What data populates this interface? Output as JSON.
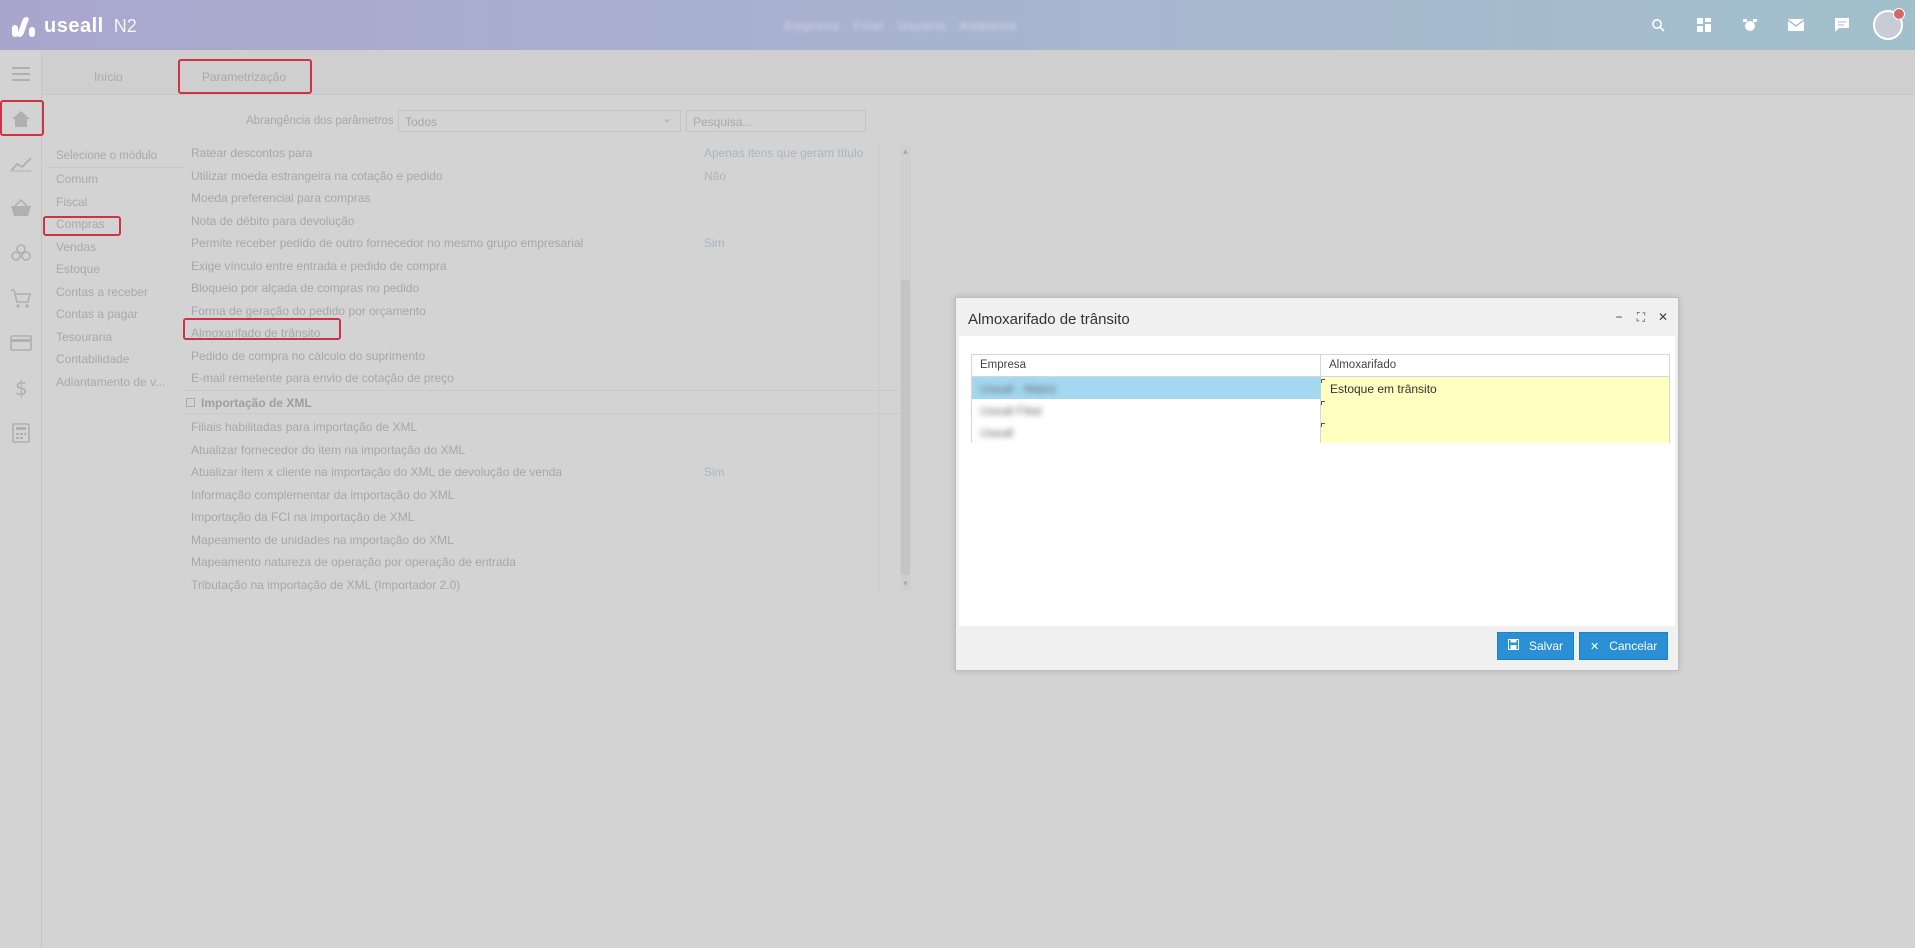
{
  "app": {
    "logo_text": "useall",
    "logo_suffix": "N2",
    "center_info": "Empresa · Filial · Usuário · Ambiente"
  },
  "topbar_icons": [
    "search-icon",
    "dashboard-icon",
    "alarm-icon",
    "mail-icon",
    "chat-icon"
  ],
  "tabs": {
    "inicio": "Início",
    "parametrizacao": "Parametrização"
  },
  "filter": {
    "label": "Abrangência dos parâmetros",
    "select_value": "Todos",
    "search_placeholder": "Pesquisa..."
  },
  "modules": {
    "header": "Selecione o módulo",
    "items": [
      "Comum",
      "Fiscal",
      "Compras",
      "Vendas",
      "Estoque",
      "Contas a receber",
      "Contas a pagar",
      "Tesouraria",
      "Contabilidade",
      "Adiantamento de v..."
    ]
  },
  "params": {
    "rows": [
      {
        "label": "Ratear descontos para",
        "value": "Apenas itens que geram título"
      },
      {
        "label": "Utilizar moeda estrangeira na cotação e pedido",
        "value": "Não"
      },
      {
        "label": "Moeda preferencial para compras",
        "value": ""
      },
      {
        "label": "Nota de débito para devolução",
        "value": ""
      },
      {
        "label": "Permite receber pedido de outro fornecedor no mesmo grupo empresarial",
        "value": "Sim"
      },
      {
        "label": "Exige vínculo entre entrada e pedido de compra",
        "value": ""
      },
      {
        "label": "Bloqueio por alçada de compras no pedido",
        "value": ""
      },
      {
        "label": "Forma de geração do pedido por orçamento",
        "value": ""
      },
      {
        "label": "Almoxarifado de trânsito",
        "value": ""
      },
      {
        "label": "Pedido de compra no cálculo do suprimento",
        "value": ""
      },
      {
        "label": "E-mail remetente para envio de cotação de preço",
        "value": ""
      }
    ],
    "group_title": "Importação de XML",
    "group_rows": [
      {
        "label": "Filiais habilitadas para importação de XML",
        "value": ""
      },
      {
        "label": "Atualizar fornecedor do item na importação do XML",
        "value": ""
      },
      {
        "label": "Atualizar item x cliente na importação do XML de devolução de venda",
        "value": "Sim"
      },
      {
        "label": "Informação complementar da importação do XML",
        "value": ""
      },
      {
        "label": "Importação da FCI na importação de XML",
        "value": ""
      },
      {
        "label": "Mapeamento de unidades na importação do XML",
        "value": ""
      },
      {
        "label": "Mapeamento natureza de operação por operação de entrada",
        "value": ""
      },
      {
        "label": "Tributação na importação de XML (Importador 2.0)",
        "value": ""
      }
    ]
  },
  "modal": {
    "title": "Almoxarifado de trânsito",
    "col_empresa": "Empresa",
    "col_almoxarifado": "Almoxarifado",
    "rows": [
      {
        "empresa": "Useall · Matriz",
        "almoxarifado": "Estoque em trânsito"
      },
      {
        "empresa": "Useall Filial",
        "almoxarifado": ""
      },
      {
        "empresa": "Useall",
        "almoxarifado": ""
      }
    ],
    "save_label": "Salvar",
    "cancel_label": "Cancelar"
  }
}
